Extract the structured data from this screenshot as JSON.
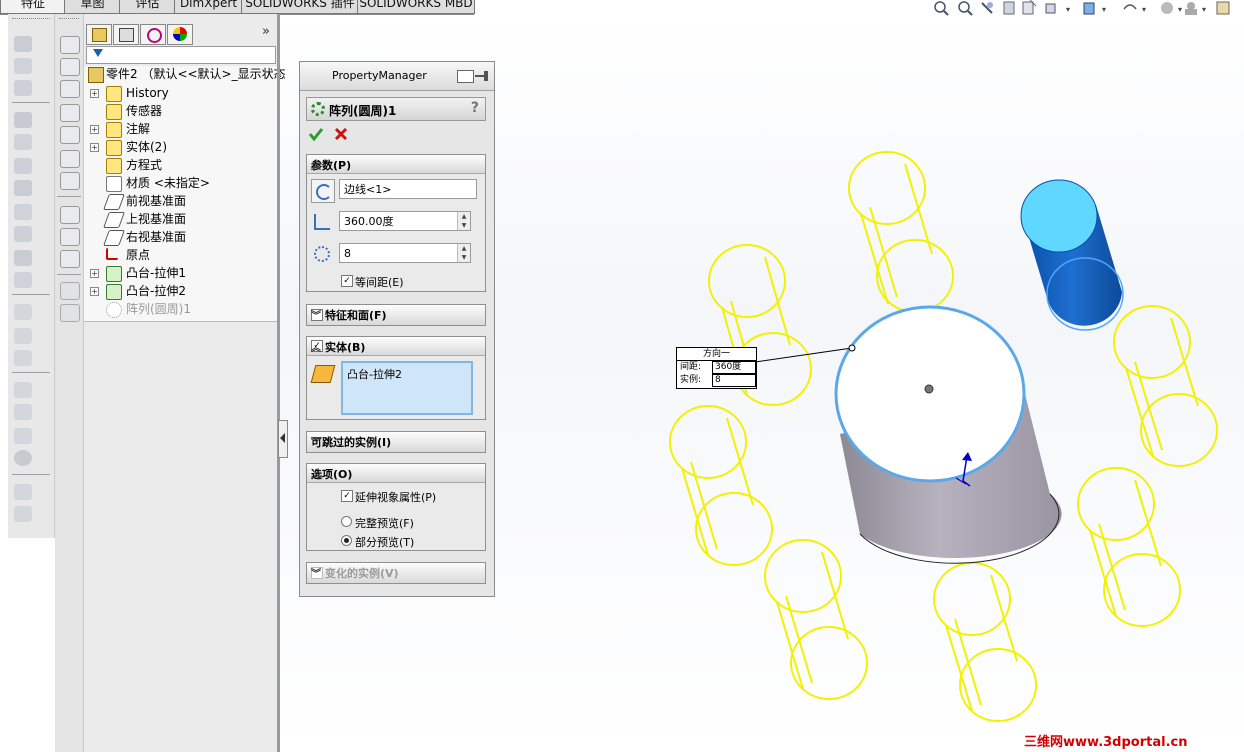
{
  "tabs": [
    {
      "label": "特征",
      "active": true
    },
    {
      "label": "草图",
      "active": false
    },
    {
      "label": "评估",
      "active": false
    },
    {
      "label": "DimXpert",
      "active": false
    },
    {
      "label": "SOLIDWORKS 插件",
      "active": false
    },
    {
      "label": "SOLIDWORKS MBD",
      "active": false
    }
  ],
  "feature_tree": {
    "root": "零件2 （默认<<默认>_显示状态",
    "items": [
      {
        "label": "History",
        "icon": "history-icon",
        "expandable": true
      },
      {
        "label": "传感器",
        "icon": "sensor-icon",
        "expandable": false
      },
      {
        "label": "注解",
        "icon": "annotation-icon",
        "expandable": true
      },
      {
        "label": "实体(2)",
        "icon": "solid-bodies-icon",
        "expandable": true
      },
      {
        "label": "方程式",
        "icon": "equation-icon",
        "expandable": false
      },
      {
        "label": "材质 <未指定>",
        "icon": "material-icon",
        "expandable": false
      },
      {
        "label": "前视基准面",
        "icon": "plane-icon",
        "expandable": false
      },
      {
        "label": "上视基准面",
        "icon": "plane-icon",
        "expandable": false
      },
      {
        "label": "右视基准面",
        "icon": "plane-icon",
        "expandable": false
      },
      {
        "label": "原点",
        "icon": "origin-icon",
        "expandable": false
      },
      {
        "label": "凸台-拉伸1",
        "icon": "extrude-icon",
        "expandable": true
      },
      {
        "label": "凸台-拉伸2",
        "icon": "extrude-icon",
        "expandable": true
      },
      {
        "label": "阵列(圆周)1",
        "icon": "circular-pattern-icon",
        "expandable": false,
        "greyed": true
      }
    ]
  },
  "property_manager": {
    "title": "PropertyManager",
    "feature_title": "阵列(圆周)1",
    "help": "?",
    "params": {
      "header": "参数(P)",
      "axis": "边线<1>",
      "angle": "360.00度",
      "instances": "8",
      "equal_spacing": "等间距(E)"
    },
    "features_faces": {
      "header": "特征和面(F)"
    },
    "bodies": {
      "header": "实体(B)",
      "selected": "凸台-拉伸2"
    },
    "skip_instances": {
      "header": "可跳过的实例(I)"
    },
    "options": {
      "header": "选项(O)",
      "propagate": "延伸视象属性(P)",
      "full_preview": "完整预览(F)",
      "partial_preview": "部分预览(T)"
    },
    "vary_instances": {
      "header": "变化的实例(V)"
    }
  },
  "callout": {
    "title": "方向一",
    "spacing_label": "间距:",
    "spacing_value": "360度",
    "instances_label": "实例:",
    "instances_value": "8"
  },
  "watermark": "三维网www.3dportal.cn",
  "colors": {
    "preview": "#f2f200",
    "selected_edge": "#5aa8e8",
    "highlight_body": "#1e6fd0"
  }
}
